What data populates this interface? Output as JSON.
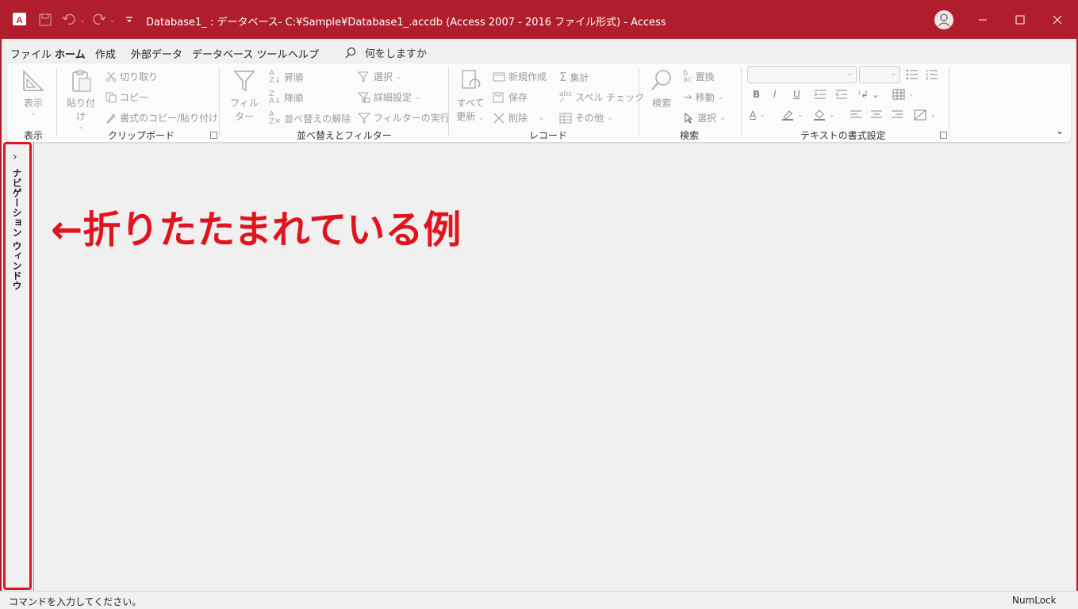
{
  "app": {
    "title": "Database1_ : データベース- C:¥Sample¥Database1_.accdb (Access 2007 - 2016 ファイル形式)  -  Access",
    "brand_color": "#b01e2e"
  },
  "quick_access": {
    "save": "save-icon",
    "undo": "undo-icon",
    "redo": "redo-icon",
    "customize": "customize-icon"
  },
  "menu": {
    "tabs": [
      "ファイル",
      "ホーム",
      "作成",
      "外部データ",
      "データベース ツール",
      "ヘルプ"
    ],
    "active_tab": "ホーム",
    "tell_me": "何をしますか"
  },
  "ribbon": {
    "view": {
      "button": "表示",
      "group": "表示"
    },
    "clipboard": {
      "paste": "貼り付け",
      "cut": "切り取り",
      "copy": "コピー",
      "format_painter": "書式のコピー/貼り付け",
      "group": "クリップボード"
    },
    "sort_filter": {
      "filter": "フィルター",
      "ascending": "昇順",
      "descending": "降順",
      "clear_sort": "並べ替えの解除",
      "selection": "選択",
      "advanced": "詳細設定",
      "toggle_filter": "フィルターの実行",
      "group": "並べ替えとフィルター"
    },
    "records": {
      "refresh_line1": "すべて",
      "refresh_line2": "更新",
      "new": "新規作成",
      "save": "保存",
      "delete": "削除",
      "totals": "集計",
      "spelling": "スペル チェック",
      "more": "その他",
      "group": "レコード"
    },
    "find": {
      "find": "検索",
      "replace": "置換",
      "goto": "移動",
      "select": "選択",
      "group": "検索"
    },
    "text_format": {
      "group": "テキストの書式設定",
      "bold": "B",
      "italic": "I",
      "underline": "U",
      "font_color": "A"
    }
  },
  "nav_pane": {
    "label": "ナビゲーション ウィンドウ"
  },
  "annotation": "←折りたたまれている例",
  "status": {
    "left": "コマンドを入力してください。",
    "right": "NumLock"
  }
}
